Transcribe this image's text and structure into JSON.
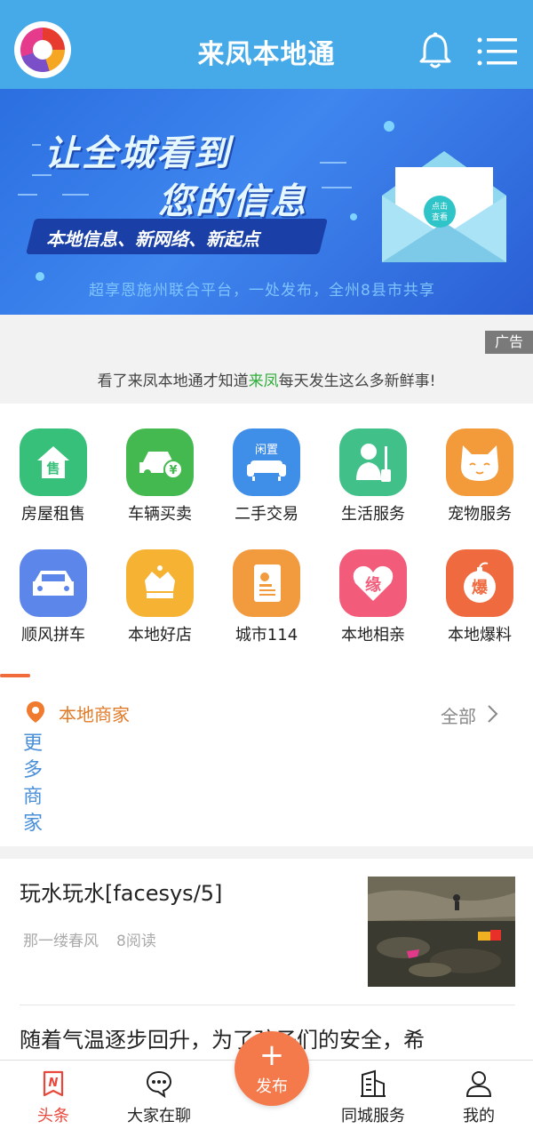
{
  "header": {
    "title": "来凤本地通",
    "logo_icon": "app-logo",
    "bell_icon": "bell-icon",
    "menu_icon": "menu-icon",
    "bg_color": "#46a9e8"
  },
  "banner": {
    "line1": "让全城看到",
    "line2": "您的信息",
    "tag": "本地信息、新网络、新起点",
    "subtitle": "超享恩施州联合平台，一处发布，全州8县市共享",
    "envelope_text_top": "点击",
    "envelope_text_bottom": "查看"
  },
  "notice": {
    "ad_badge": "广告",
    "text_before": "看了来凤本地通才知道",
    "text_highlight": "来凤",
    "text_after": "每天发生这么多新鲜事!"
  },
  "grid": {
    "items": [
      {
        "label": "房屋租售",
        "icon": "house-sale-icon",
        "color": "#36c07a",
        "glyph": "售"
      },
      {
        "label": "车辆买卖",
        "icon": "car-trade-icon",
        "color": "#43b94f",
        "glyph": "¥"
      },
      {
        "label": "二手交易",
        "icon": "sofa-icon",
        "color": "#3f8ee8",
        "glyph": "闲置"
      },
      {
        "label": "生活服务",
        "icon": "cleaner-icon",
        "color": "#42c08a",
        "glyph": ""
      },
      {
        "label": "宠物服务",
        "icon": "cat-icon",
        "color": "#f39a3a",
        "glyph": ""
      },
      {
        "label": "顺风拼车",
        "icon": "carpool-icon",
        "color": "#5d86ea",
        "glyph": ""
      },
      {
        "label": "本地好店",
        "icon": "crown-icon",
        "color": "#f5b233",
        "glyph": ""
      },
      {
        "label": "城市114",
        "icon": "phonebook-icon",
        "color": "#f29a3e",
        "glyph": ""
      },
      {
        "label": "本地相亲",
        "icon": "heart-icon",
        "color": "#f25b7a",
        "glyph": "缘"
      },
      {
        "label": "本地爆料",
        "icon": "bomb-icon",
        "color": "#f06a3f",
        "glyph": "爆"
      }
    ]
  },
  "merchants": {
    "title": "本地商家",
    "all_label": "全部",
    "more_label": "更多商家",
    "pin_icon": "location-pin-icon"
  },
  "articles": [
    {
      "title": "玩水玩水[facesys/5]",
      "author": "那一缕春风",
      "reads": "8阅读"
    },
    {
      "title": "随着气温逐步回升，为了孩子们的安全，希"
    }
  ],
  "tabbar": {
    "items": [
      {
        "label": "头条",
        "icon": "headline-icon",
        "active": true
      },
      {
        "label": "大家在聊",
        "icon": "chat-bubble-icon",
        "active": false
      },
      {
        "label": "同城服务",
        "icon": "buildings-icon",
        "active": false
      },
      {
        "label": "我的",
        "icon": "user-icon",
        "active": false
      }
    ],
    "publish": {
      "label": "发布",
      "icon": "plus-icon"
    },
    "active_color": "#e8473a",
    "publish_color": "#f47a4c"
  }
}
